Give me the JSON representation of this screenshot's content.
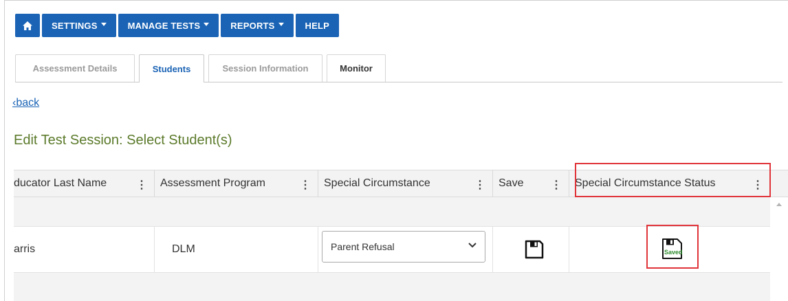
{
  "nav": {
    "home_icon": "home-icon",
    "items": [
      {
        "label": "SETTINGS",
        "has_caret": true
      },
      {
        "label": "MANAGE TESTS",
        "has_caret": true
      },
      {
        "label": "REPORTS",
        "has_caret": true
      },
      {
        "label": "HELP",
        "has_caret": false
      }
    ],
    "color": "#1a63b5"
  },
  "tabs": [
    {
      "label": "Assessment Details",
      "state": "inactive"
    },
    {
      "label": "Students",
      "state": "active"
    },
    {
      "label": "Session Information",
      "state": "inactive"
    },
    {
      "label": "Monitor",
      "state": "enabled"
    }
  ],
  "back_link": "‹back",
  "page_title": "Edit Test Session: Select Student(s)",
  "grid": {
    "columns": [
      {
        "label": "ducator Last Name"
      },
      {
        "label": "Assessment Program"
      },
      {
        "label": "Special Circumstance"
      },
      {
        "label": "Save"
      },
      {
        "label": "Special Circumstance Status"
      }
    ],
    "rows": [
      {
        "educator_last_name": "arris",
        "assessment_program": "DLM",
        "special_circumstance": "Parent Refusal",
        "save_icon": "floppy-disk-icon",
        "status_icon": "floppy-disk-saved-icon",
        "status_label": "Saved"
      }
    ]
  },
  "colors": {
    "title": "#5b7a2a",
    "highlight": "#e0343a",
    "saved_text": "#2e8b2e"
  }
}
